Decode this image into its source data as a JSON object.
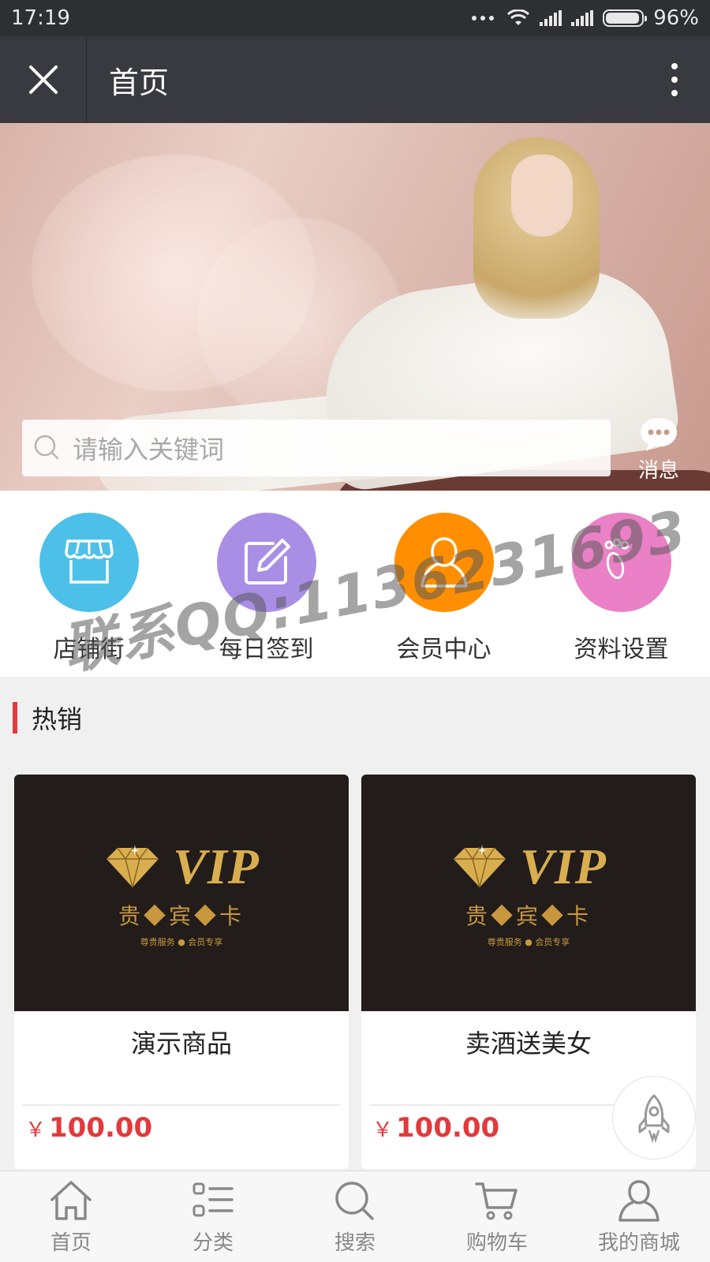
{
  "status_bar": {
    "time": "17:19",
    "battery": "96%",
    "battery_level": 0.96
  },
  "nav": {
    "title": "首页"
  },
  "search": {
    "placeholder": "请输入关键词"
  },
  "message": {
    "label": "消息"
  },
  "quick_menu": [
    {
      "label": "店铺街",
      "icon": "storefront-icon",
      "color": "#4cc0e8"
    },
    {
      "label": "每日签到",
      "icon": "edit-icon",
      "color": "#a98ee6"
    },
    {
      "label": "会员中心",
      "icon": "user-icon",
      "color": "#ff8f00"
    },
    {
      "label": "资料设置",
      "icon": "footprint-icon",
      "color": "#ea80c6"
    }
  ],
  "watermark": "联系QQ:1136231693",
  "section": {
    "title": "热销",
    "accent": "#e4393c"
  },
  "products": [
    {
      "name": "演示商品",
      "currency": "￥",
      "price": "100.00",
      "image_text": {
        "vip": "VIP",
        "sub": "贵◆宾◆卡",
        "tiny": "尊贵服务 ● 会员专享"
      }
    },
    {
      "name": "卖酒送美女",
      "currency": "￥",
      "price": "100.00",
      "image_text": {
        "vip": "VIP",
        "sub": "贵◆宾◆卡",
        "tiny": "尊贵服务 ● 会员专享"
      }
    }
  ],
  "tabs": [
    {
      "label": "首页",
      "icon": "home-icon"
    },
    {
      "label": "分类",
      "icon": "list-icon"
    },
    {
      "label": "搜索",
      "icon": "search-icon"
    },
    {
      "label": "购物车",
      "icon": "cart-icon"
    },
    {
      "label": "我的商城",
      "icon": "user-icon"
    }
  ]
}
